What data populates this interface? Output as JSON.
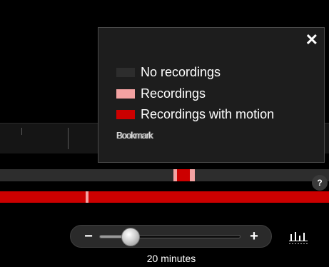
{
  "legend": {
    "close_glyph": "✕",
    "items": [
      {
        "label": "No recordings",
        "color": "#2d2d2d"
      },
      {
        "label": "Recordings",
        "color": "#f3a2a2"
      },
      {
        "label": "Recordings with motion",
        "color": "#cc0000"
      }
    ],
    "scrambled_item": {
      "label": "Bookmark",
      "color": "#dddddd"
    }
  },
  "timeline": {
    "help_label": "?",
    "track_colors": {
      "no_recording": "#2d2d2d",
      "recording": "#f3a2a2",
      "motion": "#cc0000"
    }
  },
  "zoom": {
    "minus_label": "−",
    "plus_label": "+",
    "value_label": "20 minutes",
    "level": 0.22
  },
  "icons": {
    "close": "close-icon",
    "minus": "minus-icon",
    "plus": "plus-icon",
    "help": "help-icon",
    "timeline_settings": "timeline-settings-icon"
  }
}
